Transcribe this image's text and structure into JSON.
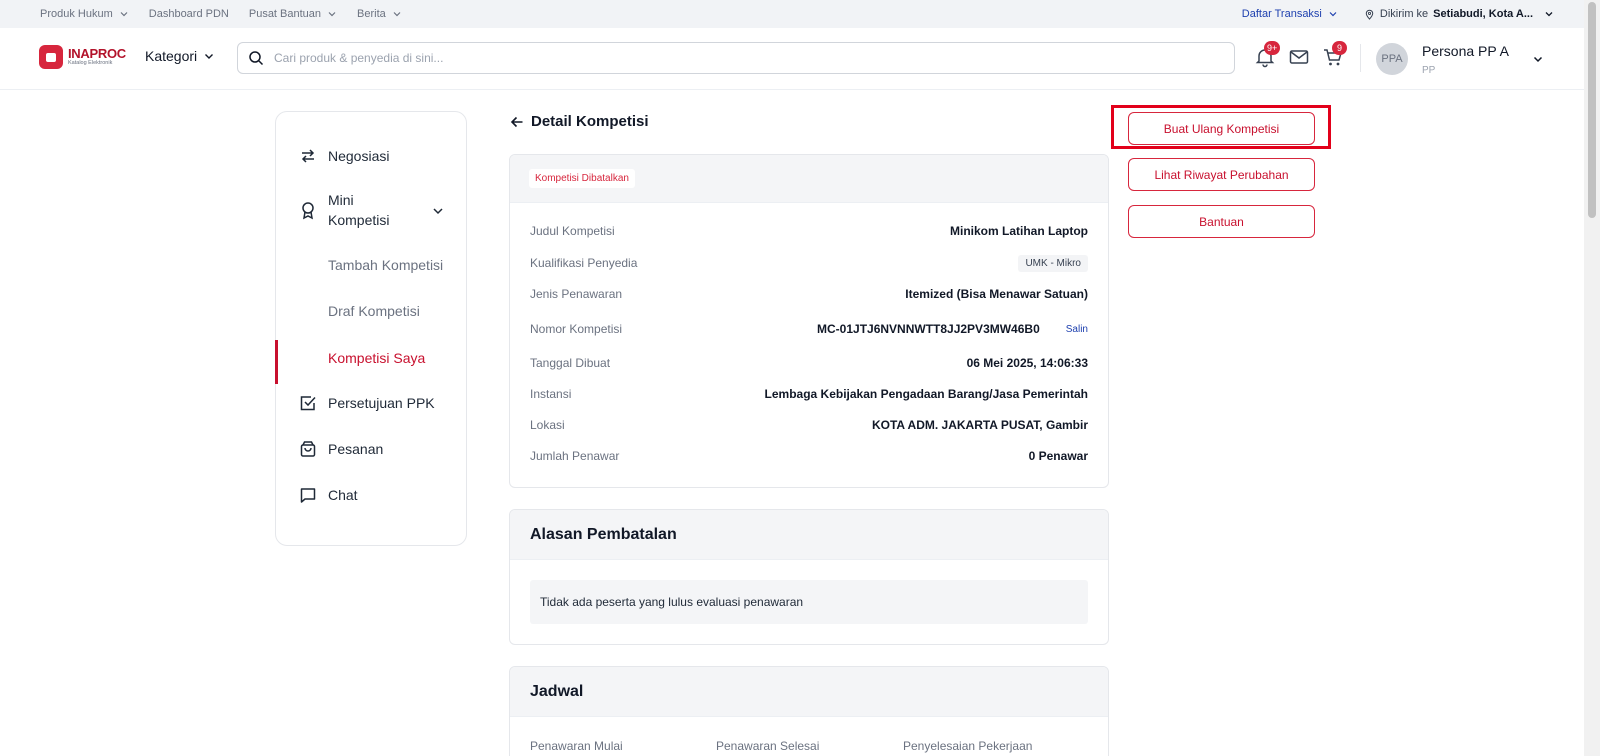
{
  "topbar": {
    "items": [
      {
        "label": "Produk Hukum",
        "has_dropdown": true
      },
      {
        "label": "Dashboard PDN",
        "has_dropdown": false
      },
      {
        "label": "Pusat Bantuan",
        "has_dropdown": true
      },
      {
        "label": "Berita",
        "has_dropdown": true
      }
    ],
    "transactions_label": "Daftar Transaksi",
    "ship_prefix": "Dikirim ke",
    "ship_location": "Setiabudi, Kota A..."
  },
  "header": {
    "logo_text": "INAPROC",
    "logo_subtext": "Katalog Elektronik",
    "category_label": "Kategori",
    "search_placeholder": "Cari produk & penyedia di sini...",
    "notification_count": "9+",
    "cart_count": "9",
    "user_initials": "PPA",
    "user_name": "Persona PP A",
    "user_role": "PP"
  },
  "sidebar": {
    "items": [
      {
        "label": "Negosiasi",
        "icon": "swap-icon"
      },
      {
        "label": "Mini Kompetisi",
        "icon": "award-icon"
      },
      {
        "label": "Persetujuan PPK",
        "icon": "check-square-icon"
      },
      {
        "label": "Pesanan",
        "icon": "bag-icon"
      },
      {
        "label": "Chat",
        "icon": "chat-icon"
      }
    ],
    "mini_kompetisi_line1": "Mini",
    "mini_kompetisi_line2": "Kompetisi",
    "sub_items": [
      "Tambah Kompetisi",
      "Draf Kompetisi",
      "Kompetisi Saya"
    ],
    "active_sub": "Kompetisi Saya"
  },
  "detail": {
    "title": "Detail Kompetisi",
    "status": "Kompetisi Dibatalkan",
    "rows": [
      {
        "key": "Judul Kompetisi",
        "value": "Minikom Latihan Laptop"
      },
      {
        "key": "Kualifikasi Penyedia",
        "value": "UMK - Mikro"
      },
      {
        "key": "Jenis Penawaran",
        "value": "Itemized (Bisa Menawar Satuan)"
      },
      {
        "key": "Nomor Kompetisi",
        "value": "MC-01JTJ6NVNNWTT8JJ2PV3MW46B0"
      },
      {
        "key": "Tanggal Dibuat",
        "value": "06 Mei 2025, 14:06:33"
      },
      {
        "key": "Instansi",
        "value": "Lembaga Kebijakan Pengadaan Barang/Jasa Pemerintah"
      },
      {
        "key": "Lokasi",
        "value": "KOTA ADM. JAKARTA PUSAT, Gambir"
      },
      {
        "key": "Jumlah Penawar",
        "value": "0 Penawar"
      }
    ],
    "copy_label": "Salin"
  },
  "cancellation": {
    "title": "Alasan Pembatalan",
    "reason": "Tidak ada peserta yang lulus evaluasi penawaran"
  },
  "schedule": {
    "title": "Jadwal",
    "columns": [
      "Penawaran Mulai",
      "Penawaran Selesai",
      "Penyelesaian Pekerjaan"
    ]
  },
  "actions": {
    "recreate": "Buat Ulang Kompetisi",
    "history": "Lihat Riwayat Perubahan",
    "help": "Bantuan"
  },
  "colors": {
    "brand": "#d7263d",
    "accent_text": "#c8102e",
    "link": "#1e40af",
    "highlight": "#e2001a"
  }
}
